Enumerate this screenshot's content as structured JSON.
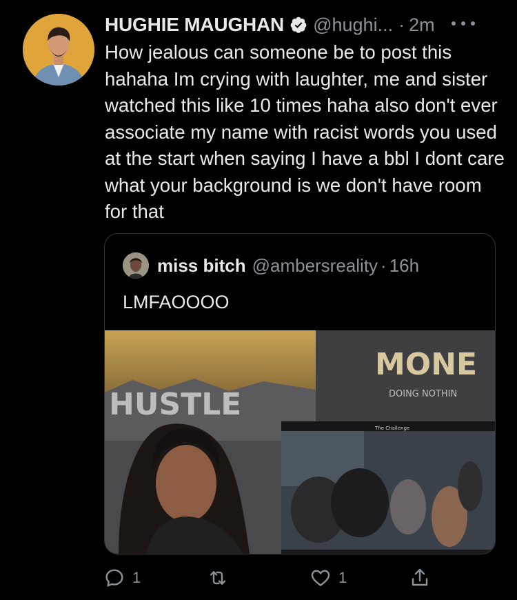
{
  "tweet": {
    "display_name": "HUGHIE MAUGHAN",
    "handle": "@hughi...",
    "separator": "·",
    "time": "2m",
    "text": "How jealous can someone be to post this hahaha Im crying with laughter, me and sister watched this like 10 times haha also don't ever associate my name with racist words you used at the start when saying I have a bbl I dont care what your background is we don't have room for that"
  },
  "quoted": {
    "display_name": "miss bitch",
    "handle": "@ambersreality",
    "separator": "·",
    "time": "16h",
    "text": "LMFAOOOO",
    "media": {
      "sign_text_right": "MONE",
      "sign_subtext_right": "DOING NOTHIN",
      "sign_text_left": "HUSTLE",
      "pip_title": "The Challenge"
    }
  },
  "actions": {
    "reply_count": "1",
    "retweet_count": "",
    "like_count": "1"
  },
  "colors": {
    "background": "#000000",
    "text_primary": "#e7e9ea",
    "text_secondary": "#8b9298",
    "border": "#2f3336"
  }
}
